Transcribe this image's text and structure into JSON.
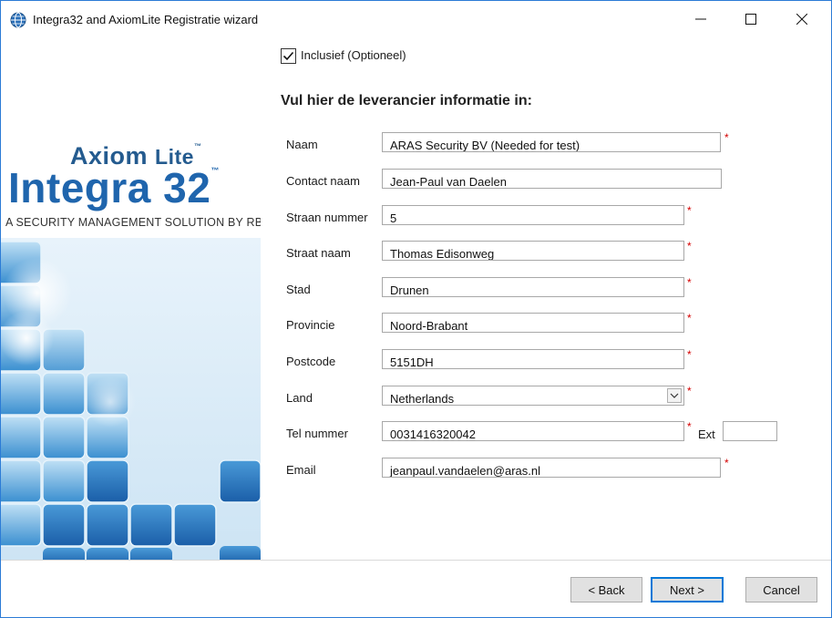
{
  "window": {
    "title": "Integra32 and AxiomLite Registratie wizard"
  },
  "branding": {
    "axiom": "Axiom",
    "lite": "Lite",
    "tm": "™",
    "integra": "Integra 32",
    "tagline": "A SECURITY MANAGEMENT SOLUTION BY RBH"
  },
  "form": {
    "inclusief_label": "Inclusief (Optioneel)",
    "inclusief_checked": true,
    "heading": "Vul hier de leverancier informatie in:",
    "required_marker": "*",
    "fields": {
      "naam": {
        "label": "Naam",
        "value": "ARAS Security BV (Needed for test)"
      },
      "contact": {
        "label": "Contact naam",
        "value": "Jean-Paul van Daelen"
      },
      "straatnr": {
        "label": "Straan nummer",
        "value": "5"
      },
      "straatnaam": {
        "label": "Straat naam",
        "value": "Thomas Edisonweg"
      },
      "stad": {
        "label": "Stad",
        "value": "Drunen"
      },
      "provincie": {
        "label": "Provincie",
        "value": "Noord-Brabant"
      },
      "postcode": {
        "label": "Postcode",
        "value": "5151DH"
      },
      "land": {
        "label": "Land",
        "value": "Netherlands"
      },
      "tel": {
        "label": "Tel nummer",
        "value": "0031416320042",
        "ext_label": "Ext",
        "ext_value": ""
      },
      "email": {
        "label": "Email",
        "value": "jeanpaul.vandaelen@aras.nl"
      }
    }
  },
  "buttons": {
    "back": "< Back",
    "next": "Next >",
    "cancel": "Cancel"
  }
}
